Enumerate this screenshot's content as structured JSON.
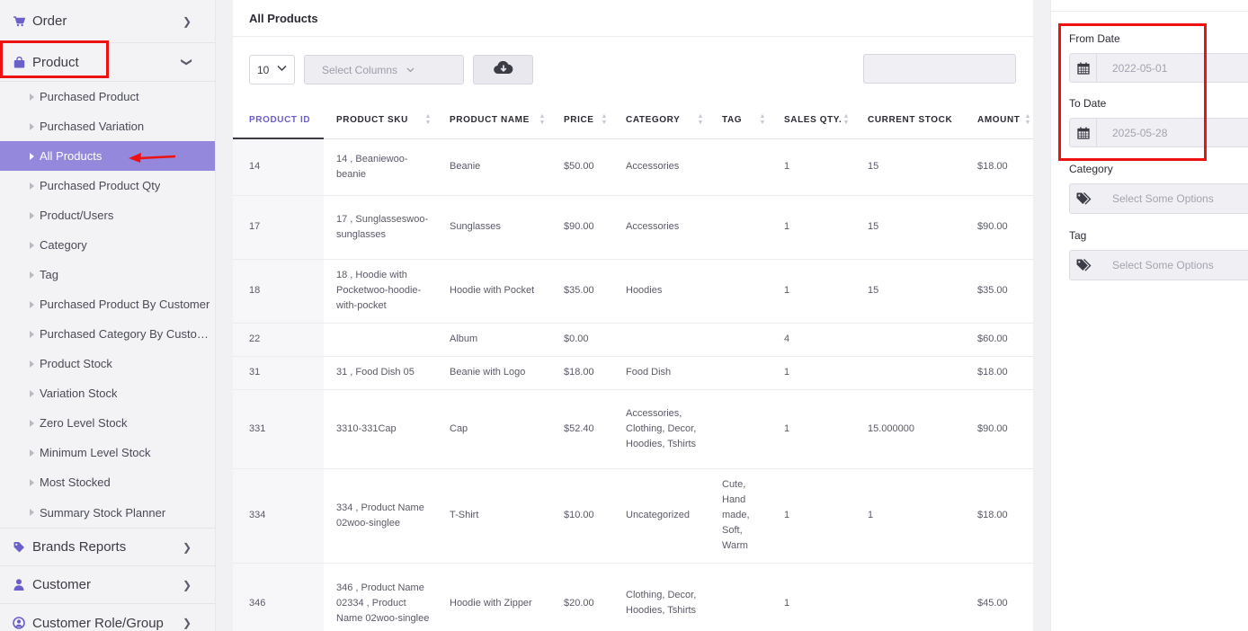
{
  "sidebar": {
    "order_label": "Order",
    "product_label": "Product",
    "sub_items": [
      {
        "label": "Purchased Product"
      },
      {
        "label": "Purchased Variation"
      },
      {
        "label": "All Products"
      },
      {
        "label": "Purchased Product Qty"
      },
      {
        "label": "Product/Users"
      },
      {
        "label": "Category"
      },
      {
        "label": "Tag"
      },
      {
        "label": "Purchased Product By Customer"
      },
      {
        "label": "Purchased Category By Customer"
      },
      {
        "label": "Product Stock"
      },
      {
        "label": "Variation Stock"
      },
      {
        "label": "Zero Level Stock"
      },
      {
        "label": "Minimum Level Stock"
      },
      {
        "label": "Most Stocked"
      },
      {
        "label": "Summary Stock Planner"
      }
    ],
    "active_item": "All Products",
    "brands_label": "Brands Reports",
    "customer_label": "Customer",
    "customer_role_label": "Customer Role/Group"
  },
  "panel": {
    "title": "All Products",
    "page_length": "10",
    "select_columns_placeholder": "Select Columns",
    "search_value": ""
  },
  "table": {
    "headers": [
      "PRODUCT ID",
      "PRODUCT SKU",
      "PRODUCT NAME",
      "PRICE",
      "CATEGORY",
      "TAG",
      "SALES QTY.",
      "CURRENT STOCK",
      "AMOUNT"
    ],
    "rows": [
      [
        "14",
        "14 , Beaniewoo-beanie",
        "Beanie",
        "$50.00",
        "Accessories",
        "",
        "1",
        "15",
        "$18.00"
      ],
      [
        "17",
        "17 , Sunglasseswoo-sunglasses",
        "Sunglasses",
        "$90.00",
        "Accessories",
        "",
        "1",
        "15",
        "$90.00"
      ],
      [
        "18",
        "18 , Hoodie with Pocketwoo-hoodie-with-pocket",
        "Hoodie with Pocket",
        "$35.00",
        "Hoodies",
        "",
        "1",
        "15",
        "$35.00"
      ],
      [
        "22",
        "",
        "Album",
        "$0.00",
        "",
        "",
        "4",
        "",
        "$60.00"
      ],
      [
        "31",
        "31 , Food Dish 05",
        "Beanie with Logo",
        "$18.00",
        "Food Dish",
        "",
        "1",
        "",
        "$18.00"
      ],
      [
        "331",
        "3310-331Cap",
        "Cap",
        "$52.40",
        "Accessories, Clothing, Decor, Hoodies, Tshirts",
        "",
        "1",
        "15.000000",
        "$90.00"
      ],
      [
        "334",
        "334 , Product Name 02woo-singlee",
        "T-Shirt",
        "$10.00",
        "Uncategorized",
        "Cute, Hand made, Soft, Warm",
        "1",
        "1",
        "$18.00"
      ],
      [
        "346",
        "346 , Product Name 02334 , Product Name 02woo-singlee",
        "Hoodie with Zipper",
        "$20.00",
        "Clothing, Decor, Hoodies, Tshirts",
        "",
        "1",
        "",
        "$45.00"
      ]
    ]
  },
  "filters": {
    "from_date_label": "From Date",
    "from_date_value": "2022-05-01",
    "to_date_label": "To Date",
    "to_date_value": "2025-05-28",
    "category_label": "Category",
    "category_placeholder": "Select Some Options",
    "tag_label": "Tag",
    "tag_placeholder": "Select Some Options"
  },
  "colors": {
    "accent": "#6b5fc9",
    "active_bg": "#9488dc",
    "annotation_red": "#ee1111"
  },
  "icons": {
    "order": "cart-icon",
    "product": "bag-icon",
    "brands": "tag-icon",
    "customer": "user-icon",
    "customer_role": "user-circle-icon",
    "download": "cloud-download-icon",
    "date": "calendar-icon",
    "filter": "tags-icon"
  }
}
